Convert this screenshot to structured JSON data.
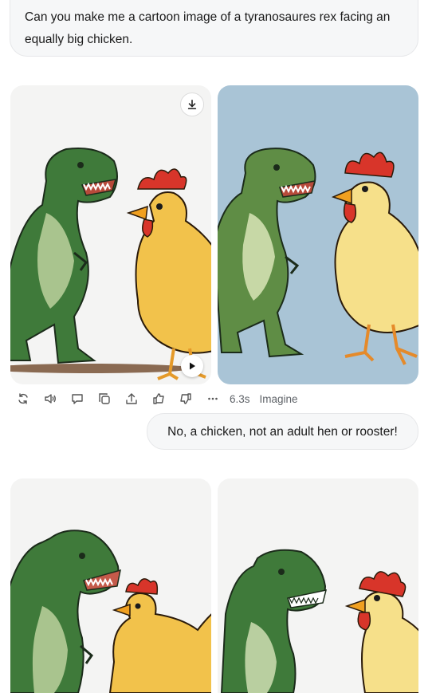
{
  "messages": {
    "first_prompt": "Can you make me a cartoon image of a tyranosaures rex facing an equally big chicken.",
    "second_prompt": "No, a chicken, not an adult hen or rooster!"
  },
  "response": {
    "time": "6.3s",
    "model": "Imagine",
    "actions": [
      "regenerate-icon",
      "speaker-icon",
      "comment-icon",
      "copy-icon",
      "share-icon",
      "thumbs-up-icon",
      "thumbs-down-icon",
      "more-icon"
    ]
  },
  "colors": {
    "bubble_bg": "#f6f7f8",
    "trex_green": "#3f7a3a",
    "trex_belly": "#a9c48e",
    "chicken_yellow": "#f2c24b",
    "comb_red": "#d8352a",
    "sky_blue": "#a9c4d6"
  }
}
